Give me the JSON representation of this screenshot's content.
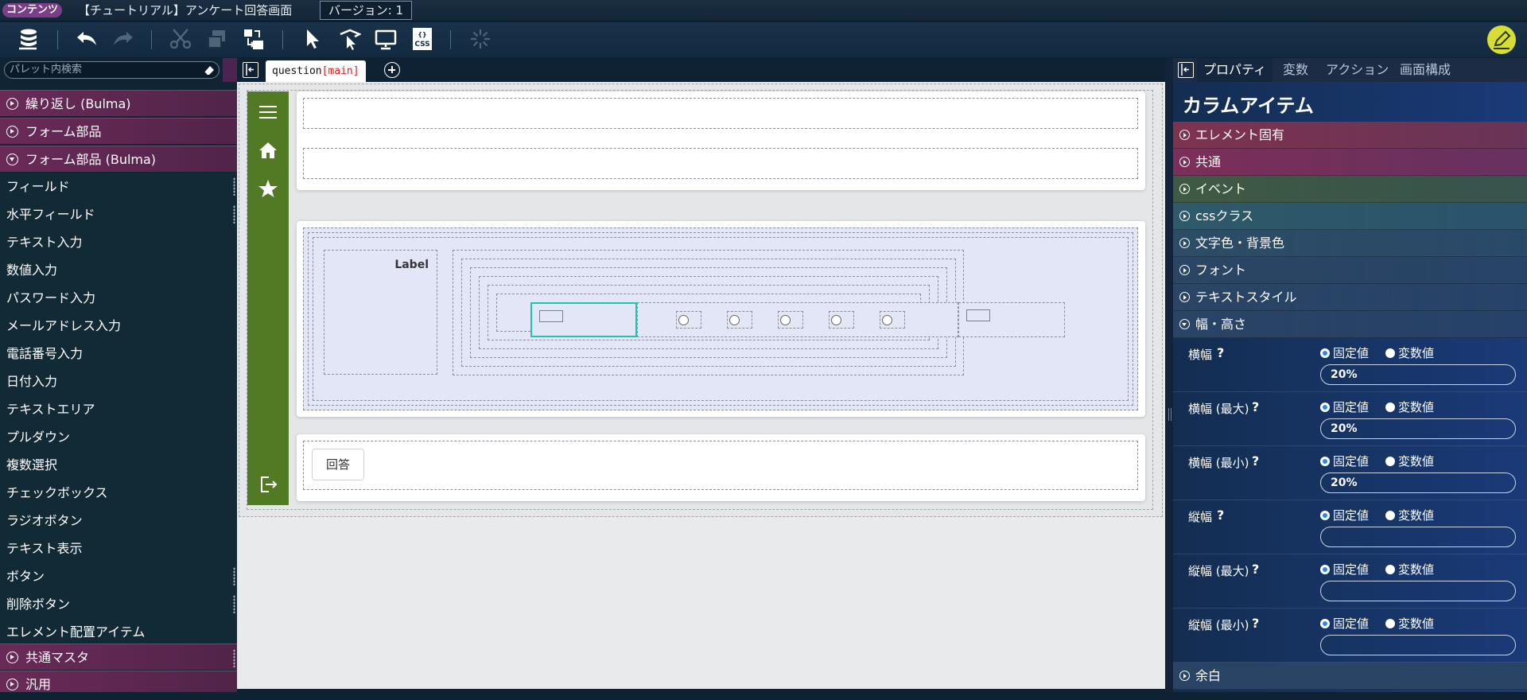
{
  "titlebar": {
    "tag": "コンテンツ",
    "title": "【チュートリアル】アンケート回答画面",
    "version": "バージョン: 1"
  },
  "toolbar": {
    "icons": [
      "database-icon",
      "undo-icon",
      "redo-icon",
      "cut-icon",
      "copy-icon",
      "paste-icon",
      "select-icon",
      "move-icon",
      "preview-icon",
      "css-icon",
      "loading-icon",
      "edit-icon"
    ],
    "css_label": "CSS"
  },
  "palette": {
    "search_placeholder": "パレット内検索",
    "top_categories": [
      {
        "label": "繰り返し (Bulma)"
      },
      {
        "label": "フォーム部品"
      },
      {
        "label": "フォーム部品 (Bulma)"
      }
    ],
    "items": [
      {
        "label": "フィールド"
      },
      {
        "label": "水平フィールド"
      },
      {
        "label": "テキスト入力"
      },
      {
        "label": "数値入力"
      },
      {
        "label": "パスワード入力"
      },
      {
        "label": "メールアドレス入力"
      },
      {
        "label": "電話番号入力"
      },
      {
        "label": "日付入力"
      },
      {
        "label": "テキストエリア"
      },
      {
        "label": "プルダウン"
      },
      {
        "label": "複数選択"
      },
      {
        "label": "チェックボックス"
      },
      {
        "label": "ラジオボタン"
      },
      {
        "label": "テキスト表示"
      },
      {
        "label": "ボタン"
      },
      {
        "label": "削除ボタン"
      },
      {
        "label": "エレメント配置アイテム"
      }
    ],
    "bottom_categories": [
      {
        "label": "共通マスタ"
      },
      {
        "label": "汎用"
      }
    ]
  },
  "editor": {
    "tab_name": "question",
    "tab_suffix": "[main]",
    "label_text": "Label",
    "answer_button": "回答",
    "sidebar_icons": [
      "menu-icon",
      "home-icon",
      "star-icon",
      "logout-icon"
    ]
  },
  "properties": {
    "tabs": [
      {
        "label": "プロパティ"
      },
      {
        "label": "変数"
      },
      {
        "label": "アクション"
      },
      {
        "label": "画面構成"
      }
    ],
    "heading": "カラムアイテム",
    "sections": [
      {
        "label": "エレメント固有",
        "color": "#7d3350"
      },
      {
        "label": "共通",
        "color": "#7b2f5a"
      },
      {
        "label": "イベント",
        "color": "#3f5a44"
      },
      {
        "label": "cssクラス",
        "color": "#2e5a6a"
      },
      {
        "label": "文字色・背景色",
        "color": "#2d4d66"
      },
      {
        "label": "フォント",
        "color": "#2b4664"
      },
      {
        "label": "テキストスタイル",
        "color": "#2a4566"
      },
      {
        "label": "幅・高さ",
        "color": "#2a4466"
      }
    ],
    "radio_fixed": "固定値",
    "radio_variable": "変数値",
    "rows": [
      {
        "label": "横幅",
        "value": ""
      },
      {
        "label": "横幅 (最大)",
        "value": ""
      },
      {
        "label": "横幅 (最小)",
        "value": ""
      },
      {
        "label": "縦幅",
        "value": ""
      },
      {
        "label": "縦幅 (最大)",
        "value": ""
      },
      {
        "label": "縦幅 (最小)",
        "value": ""
      }
    ],
    "width_values": [
      "20%",
      "20%",
      "20%"
    ],
    "bottom_section": "余白"
  }
}
